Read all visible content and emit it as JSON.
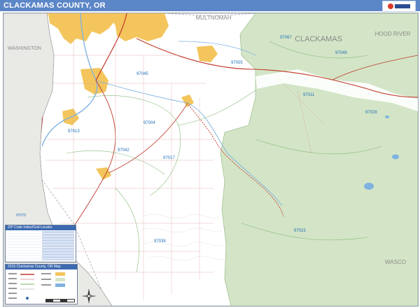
{
  "header": {
    "title": "CLACKAMAS COUNTY, OR"
  },
  "map": {
    "county_labels": {
      "multnomah": "MULTNOMAH",
      "washington": "WASHINGTON",
      "clackamas": "CLACKAMAS",
      "hood_river": "HOOD RIVER",
      "wasco": "WASCO"
    },
    "zip_labels": {
      "z97067": "97067",
      "z97049": "97049",
      "z97055": "97055",
      "z97045": "97045",
      "z97011": "97011",
      "z97028": "97028",
      "z97004": "97004",
      "z97013": "97013",
      "z97042": "97042",
      "z97017": "97017",
      "z97023": "97023",
      "z97038": "97038",
      "z97070": "97070"
    },
    "colors": {
      "national_forest": "#d3e5c6",
      "urban": "#f3c55c",
      "county_land": "#ffffff",
      "outside": "#e9e9e6",
      "water": "#7fb2e0",
      "highway": "#c0392b",
      "road": "#d9a6a6",
      "zip_line": "#7bb36b",
      "boundary": "#9b9b9b"
    }
  },
  "zip_index": {
    "header": "ZIP Code Index/Grid Locator"
  },
  "inset": {
    "header": "2016 Clackamas County, OR Map"
  }
}
